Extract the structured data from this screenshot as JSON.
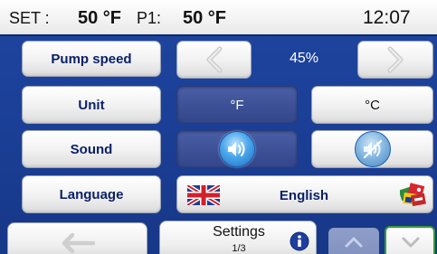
{
  "status": {
    "set_label": "SET :",
    "set_value": "50 °F",
    "p1_label": "P1:",
    "p1_value": "50 °F",
    "time": "12:07"
  },
  "rows": {
    "pump_speed": {
      "label": "Pump speed",
      "value": "45%"
    },
    "unit": {
      "label": "Unit",
      "option_f": "°F",
      "option_c": "°C",
      "selected": "°F"
    },
    "sound": {
      "label": "Sound",
      "on_icon": "speaker-on-icon",
      "off_icon": "speaker-muted-icon",
      "selected": "on"
    },
    "language": {
      "label": "Language",
      "value": "English",
      "flag_icon": "uk-flag-icon",
      "world_flags_icon": "world-flags-icon"
    }
  },
  "footer": {
    "title": "Settings",
    "page": "1/3",
    "back_icon": "back-arrow-icon",
    "info_icon": "info-icon",
    "up_icon": "chevron-up-icon",
    "down_icon": "chevron-down-icon"
  },
  "colors": {
    "background": "#1b3f96",
    "selected": "#3c4f95",
    "button_text": "#0a1f66",
    "info": "#1f3f9e"
  }
}
